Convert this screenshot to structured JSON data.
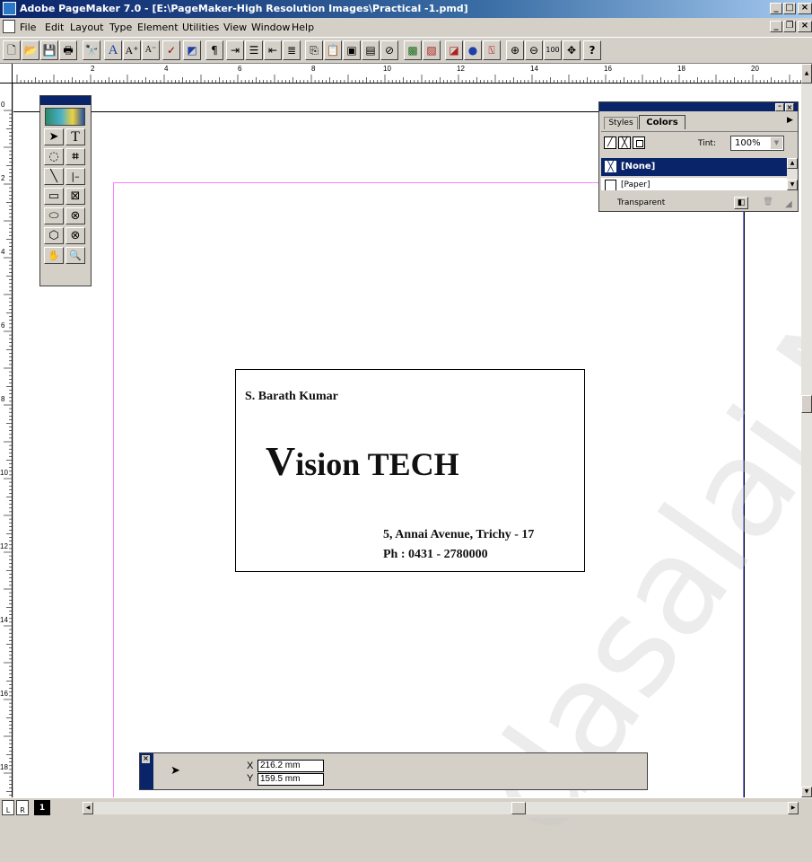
{
  "window": {
    "title": "Adobe PageMaker 7.0 - [E:\\PageMaker-High Resolution Images\\Practical -1.pmd]",
    "controls": [
      "minimize",
      "maximize",
      "close"
    ]
  },
  "menubar": {
    "items": [
      "File",
      "Edit",
      "Layout",
      "Type",
      "Element",
      "Utilities",
      "View",
      "Window",
      "Help"
    ]
  },
  "toolbar": {
    "icons": [
      "new-icon",
      "open-icon",
      "save-icon",
      "print-icon",
      "find-icon",
      "font-icon",
      "font-size-up-icon",
      "font-size-down-icon",
      "spelling-icon",
      "frame-icon",
      "paragraph-icon",
      "indent-icon",
      "bullets-icon",
      "outdent-icon",
      "indent-right-icon",
      "copy-icon",
      "paste-icon",
      "place-icon",
      "story-icon",
      "links-icon",
      "image-icon",
      "crop-icon",
      "color-icon",
      "web-icon",
      "pdf-icon",
      "zoom-in-icon",
      "zoom-out-icon",
      "actual-size-icon",
      "hand-icon",
      "help-icon"
    ],
    "zoom_label": "100",
    "help_label": "?"
  },
  "rulers": {
    "horizontal_labels": [
      "2",
      "4",
      "6",
      "8",
      "10",
      "12",
      "14",
      "16",
      "18",
      "20"
    ],
    "vertical_labels": [
      "0",
      "2",
      "4",
      "6",
      "8",
      "10",
      "12",
      "14",
      "16",
      "18"
    ]
  },
  "toolbox": {
    "tools": [
      {
        "name": "pointer-tool",
        "glyph": "➤"
      },
      {
        "name": "text-tool",
        "glyph": "T"
      },
      {
        "name": "rotate-tool",
        "glyph": "◌"
      },
      {
        "name": "crop-tool",
        "glyph": "⌗"
      },
      {
        "name": "line-tool",
        "glyph": "╲"
      },
      {
        "name": "constrained-line-tool",
        "glyph": "|–"
      },
      {
        "name": "rectangle-tool",
        "glyph": "▭"
      },
      {
        "name": "rectangle-frame-tool",
        "glyph": "⊠"
      },
      {
        "name": "ellipse-tool",
        "glyph": "⬭"
      },
      {
        "name": "ellipse-frame-tool",
        "glyph": "⊗"
      },
      {
        "name": "polygon-tool",
        "glyph": "⬡"
      },
      {
        "name": "polygon-frame-tool",
        "glyph": "⊗"
      },
      {
        "name": "hand-tool",
        "glyph": "✋"
      },
      {
        "name": "zoom-tool",
        "glyph": "🔍"
      }
    ]
  },
  "colors_panel": {
    "tabs": [
      "Styles",
      "Colors"
    ],
    "active_tab": "Colors",
    "tint_label": "Tint:",
    "tint_value": "100%",
    "swatches": [
      "[None]",
      "[Paper]"
    ],
    "selected_swatch": "[None]",
    "footer_text": "Transparent"
  },
  "card": {
    "name": "S. Barath Kumar",
    "company_initial": "V",
    "company_rest": "ision TECH",
    "address": "5, Annai Avenue, Trichy - 17",
    "phone": "Ph : 0431 - 2780000"
  },
  "control_palette": {
    "x_label": "X",
    "x_value": "216.2 mm",
    "y_label": "Y",
    "y_value": "159.5 mm"
  },
  "bottom": {
    "page_left": "L",
    "page_right": "R",
    "page_number": "1"
  },
  "watermark": "dasalai.Ne",
  "colors": {
    "title_bar": "#0a246a",
    "selected_swatch_bg": "#0a246a",
    "margin_pink": "#ff80ff",
    "guide_blue": "#8080ff"
  }
}
